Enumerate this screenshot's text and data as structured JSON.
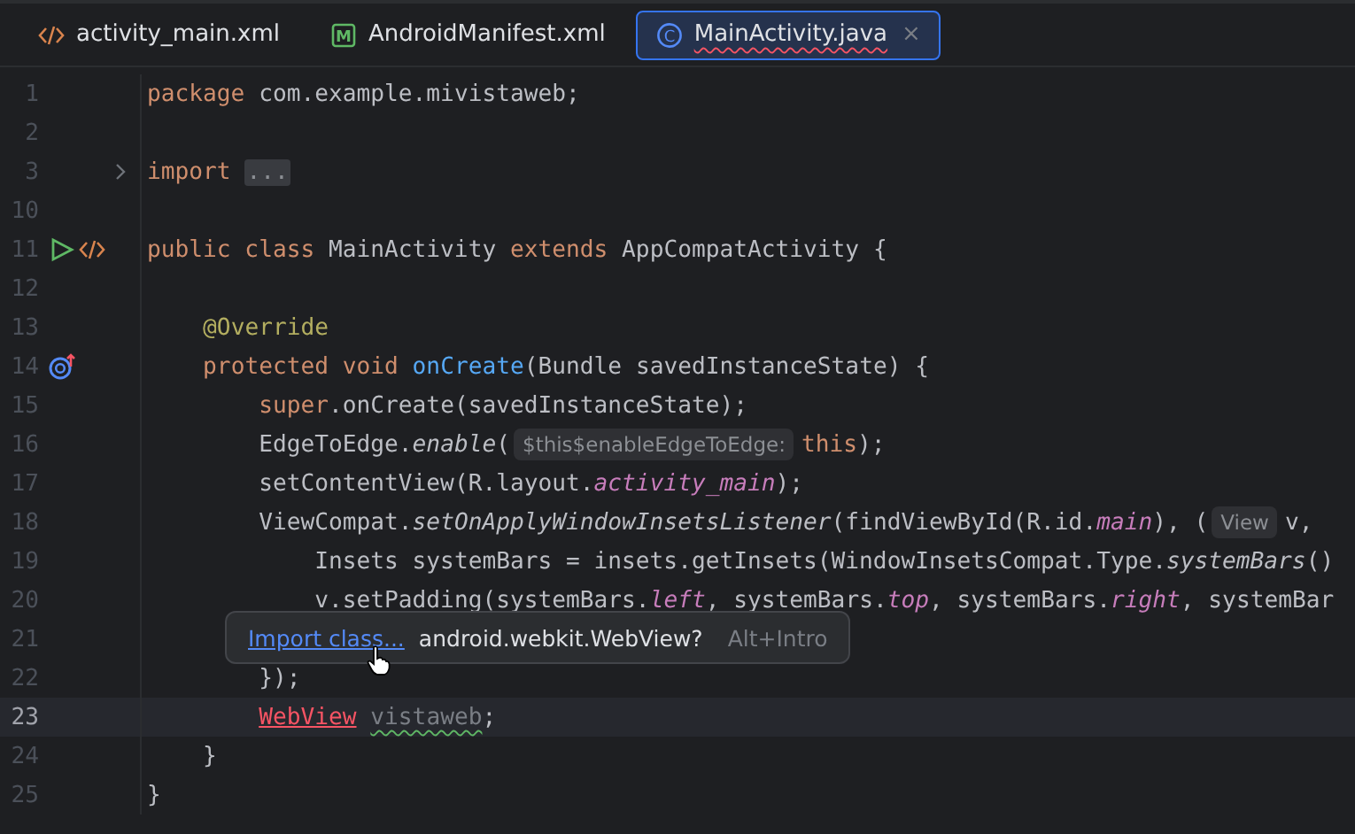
{
  "tabs": [
    {
      "kind": "markup",
      "label": "activity_main.xml",
      "selected": false,
      "has_error": false
    },
    {
      "kind": "manifest",
      "icon_text": "M",
      "label": "AndroidManifest.xml",
      "selected": false,
      "has_error": false
    },
    {
      "kind": "class",
      "icon_text": "C",
      "label": "MainActivity.java",
      "selected": true,
      "has_error": true,
      "close": "×"
    }
  ],
  "editor": {
    "lines": [
      {
        "number": "1",
        "tokens": [
          {
            "text": "package ",
            "kind": "keyword"
          },
          {
            "text": "com.example.mivistaweb;",
            "kind": "plain"
          }
        ]
      },
      {
        "number": "2"
      },
      {
        "number": "3",
        "fold_marker": true,
        "tokens": [
          {
            "text": "import ",
            "kind": "keyword"
          },
          {
            "text": "...",
            "kind": "fold"
          }
        ]
      },
      {
        "number": "10"
      },
      {
        "number": "11",
        "gutter_icons": [
          {
            "kind": "run"
          },
          {
            "kind": "markup"
          }
        ],
        "tokens": [
          {
            "text": "public class ",
            "kind": "keyword"
          },
          {
            "text": "MainActivity ",
            "kind": "plain"
          },
          {
            "text": "extends ",
            "kind": "keyword"
          },
          {
            "text": "AppCompatActivity {",
            "kind": "plain"
          }
        ]
      },
      {
        "number": "12"
      },
      {
        "number": "13",
        "tokens": [
          {
            "text": "    @Override",
            "kind": "annotation"
          }
        ]
      },
      {
        "number": "14",
        "gutter_icons": [
          {
            "kind": "override"
          }
        ],
        "tokens": [
          {
            "text": "    protected void ",
            "kind": "keyword"
          },
          {
            "text": "onCreate",
            "kind": "declaration"
          },
          {
            "text": "(Bundle savedInstanceState) {",
            "kind": "plain"
          }
        ]
      },
      {
        "number": "15",
        "tokens": [
          {
            "text": "        super",
            "kind": "keyword"
          },
          {
            "text": ".onCreate(savedInstanceState);",
            "kind": "plain"
          }
        ]
      },
      {
        "number": "16",
        "tokens": [
          {
            "text": "        EdgeToEdge.",
            "kind": "plain"
          },
          {
            "text": "enable",
            "kind": "static"
          },
          {
            "text": "(",
            "kind": "plain"
          },
          {
            "text": "$this$enableEdgeToEdge:",
            "kind": "hint"
          },
          {
            "text": "this",
            "kind": "keyword"
          },
          {
            "text": ");",
            "kind": "plain"
          }
        ]
      },
      {
        "number": "17",
        "tokens": [
          {
            "text": "        setContentView(R.layout.",
            "kind": "plain"
          },
          {
            "text": "activity_main",
            "kind": "field"
          },
          {
            "text": ");",
            "kind": "plain"
          }
        ]
      },
      {
        "number": "18",
        "tokens": [
          {
            "text": "        ViewCompat.",
            "kind": "plain"
          },
          {
            "text": "setOnApplyWindowInsetsListener",
            "kind": "static"
          },
          {
            "text": "(findViewById(R.id.",
            "kind": "plain"
          },
          {
            "text": "main",
            "kind": "field"
          },
          {
            "text": "), (",
            "kind": "plain"
          },
          {
            "text": "View",
            "kind": "hint"
          },
          {
            "text": "v,",
            "kind": "plain"
          }
        ]
      },
      {
        "number": "19",
        "tokens": [
          {
            "text": "            Insets systemBars = insets.getInsets(WindowInsetsCompat.Type.",
            "kind": "plain"
          },
          {
            "text": "systemBars",
            "kind": "static"
          },
          {
            "text": "()",
            "kind": "plain"
          }
        ]
      },
      {
        "number": "20",
        "tokens": [
          {
            "text": "            v.setPadding(systemBars.",
            "kind": "plain"
          },
          {
            "text": "left",
            "kind": "field"
          },
          {
            "text": ", systemBars.",
            "kind": "plain"
          },
          {
            "text": "top",
            "kind": "field"
          },
          {
            "text": ", systemBars.",
            "kind": "plain"
          },
          {
            "text": "right",
            "kind": "field"
          },
          {
            "text": ", systemBar",
            "kind": "plain"
          }
        ]
      },
      {
        "number": "21"
      },
      {
        "number": "22",
        "tokens": [
          {
            "text": "        });",
            "kind": "plain"
          }
        ]
      },
      {
        "number": "23",
        "current": true,
        "tokens": [
          {
            "text": "        WebView",
            "kind": "error"
          },
          {
            "text": " vistaweb",
            "kind": "unused"
          },
          {
            "text": ";",
            "kind": "plain"
          }
        ]
      },
      {
        "number": "24",
        "tokens": [
          {
            "text": "    }",
            "kind": "plain"
          }
        ]
      },
      {
        "number": "25",
        "tokens": [
          {
            "text": "}",
            "kind": "plain"
          }
        ]
      }
    ]
  },
  "popup": {
    "link": "Import class...",
    "message": "android.webkit.WebView?",
    "shortcut": "Alt+Intro"
  }
}
